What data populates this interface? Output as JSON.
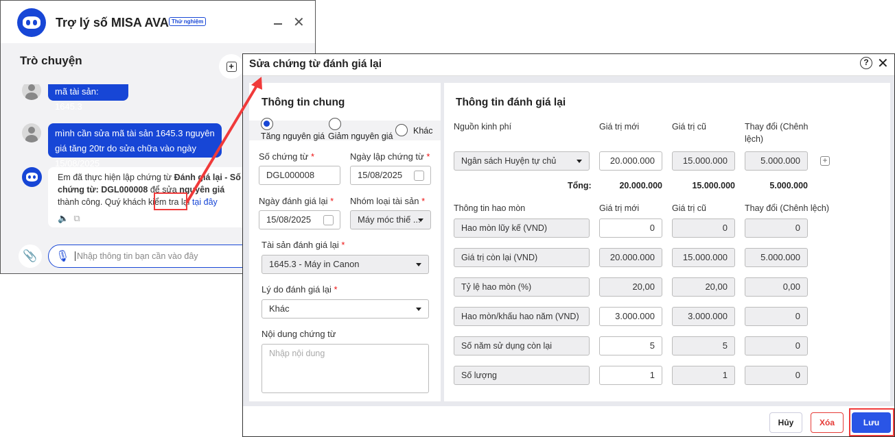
{
  "chat": {
    "title": "Trợ lý số MISA AVA",
    "badge": "Thử nghiệm",
    "section": "Trò chuyện",
    "messages": [
      {
        "from": "user",
        "text": "mã tài sản: 1645.3"
      },
      {
        "from": "user",
        "text": "mình cần sửa mã tài sản 1645.3 nguyên giá tăng 20tr do sửa chữa vào ngày 15/08/2025"
      },
      {
        "from": "bot",
        "p1": "Em đã thực hiện lập chứng từ ",
        "b1": "Đánh giá lại - Số chứng từ: DGL000008",
        "p2": " để sửa ",
        "b2": "nguyên giá",
        "p3": " thành công. Quý khách kiểm tra lại ",
        "link": "tại đây"
      }
    ],
    "input_placeholder": "Nhập thông tin bạn cần vào đây"
  },
  "dialog": {
    "title": "Sửa chứng từ đánh giá lại",
    "general": {
      "heading": "Thông tin chung",
      "radios": [
        {
          "label": "Tăng nguyên giá",
          "checked": true
        },
        {
          "label": "Giảm nguyên giá",
          "checked": false
        },
        {
          "label": "Khác",
          "checked": false
        }
      ],
      "voucher_no_label": "Số chứng từ",
      "voucher_no": "DGL000008",
      "voucher_date_label": "Ngày lập chứng từ",
      "voucher_date": "15/08/2025",
      "reval_date_label": "Ngày đánh giá lại",
      "reval_date": "15/08/2025",
      "asset_group_label": "Nhóm loại tài sản",
      "asset_group": "Máy móc thiế ...",
      "asset_label": "Tài sản đánh giá lại",
      "asset": "1645.3 - Máy in Canon",
      "reason_label": "Lý do đánh giá lại",
      "reason": "Khác",
      "content_label": "Nội dung chứng từ",
      "content_placeholder": "Nhập nội dung",
      "required_mark": "*"
    },
    "reval": {
      "heading": "Thông tin đánh giá lại",
      "fund_headers": [
        "Nguồn kinh phí",
        "Giá trị mới",
        "Giá trị cũ",
        "Thay đổi (Chênh lệch)"
      ],
      "fund_row": {
        "source": "Ngân sách Huyện tự chủ",
        "new": "20.000.000",
        "old": "15.000.000",
        "diff": "5.000.000"
      },
      "total": {
        "label": "Tổng:",
        "new": "20.000.000",
        "old": "15.000.000",
        "diff": "5.000.000"
      },
      "dep_headers": [
        "Thông tin hao mòn",
        "Giá trị mới",
        "Giá trị cũ",
        "Thay đổi (Chênh lệch)"
      ],
      "dep_rows": [
        {
          "label": "Hao mòn lũy kế (VND)",
          "new": "0",
          "old": "0",
          "diff": "0",
          "editable": true
        },
        {
          "label": "Giá trị còn lại (VND)",
          "new": "20.000.000",
          "old": "15.000.000",
          "diff": "5.000.000",
          "editable": false
        },
        {
          "label": "Tỷ lệ hao mòn (%)",
          "new": "20,00",
          "old": "20,00",
          "diff": "0,00",
          "editable": false
        },
        {
          "label": "Hao mòn/khấu hao năm (VND)",
          "new": "3.000.000",
          "old": "3.000.000",
          "diff": "0",
          "editable": true
        },
        {
          "label": "Số năm sử dụng còn lại",
          "new": "5",
          "old": "5",
          "diff": "0",
          "editable": true
        },
        {
          "label": "Số lượng",
          "new": "1",
          "old": "1",
          "diff": "0",
          "editable": true
        }
      ]
    },
    "footer": {
      "cancel": "Hủy",
      "delete": "Xóa",
      "save": "Lưu"
    }
  },
  "colors": {
    "accent": "#1746d6",
    "highlight": "#f03a3a",
    "delete": "#e53935"
  }
}
